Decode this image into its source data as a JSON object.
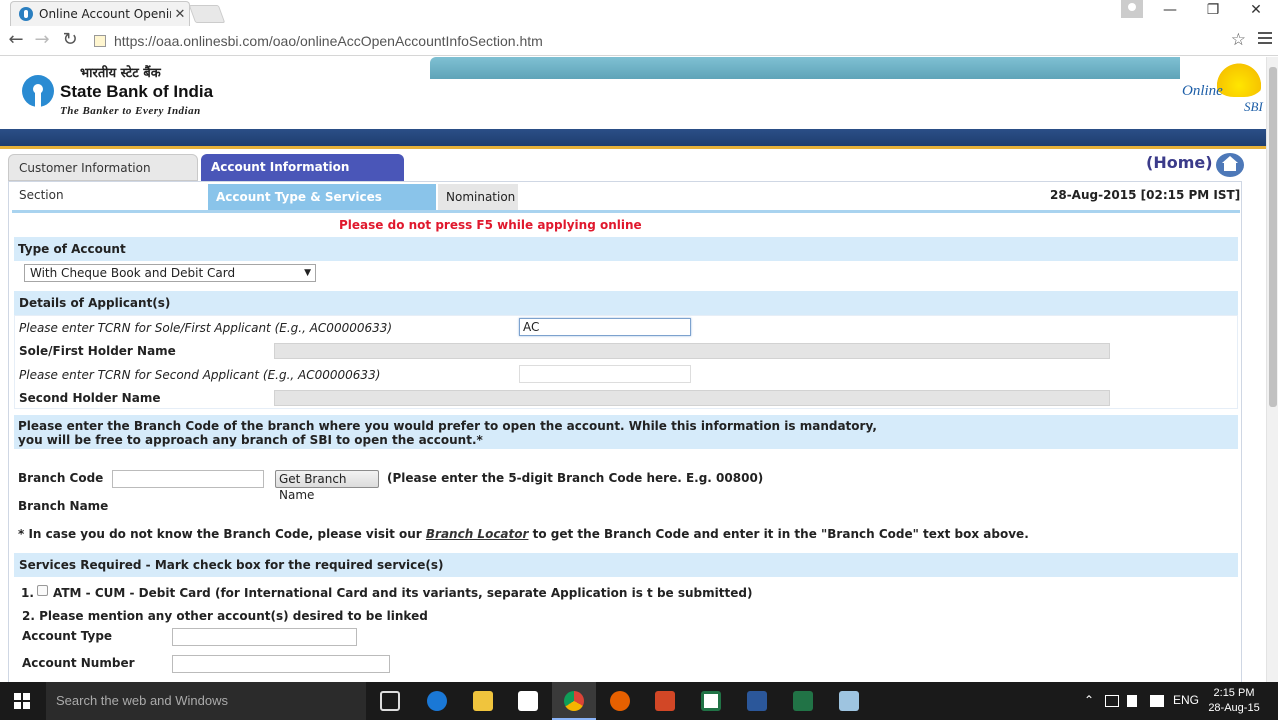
{
  "browser": {
    "tab_title": "Online Account Opening",
    "tab_close": "✕",
    "url": "https://oaa.onlinesbi.com/oao/onlineAccOpenAccountInfoSection.htm",
    "back_glyph": "←",
    "forward_glyph": "→",
    "reload_glyph": "↻",
    "star_glyph": "☆",
    "win_minimize": "—",
    "win_restore": "❐",
    "win_close": "✕"
  },
  "header": {
    "logo_hindi": "भारतीय स्टेट बैंक",
    "logo_name": "State Bank of India",
    "logo_tagline": "The Banker to Every Indian",
    "online_label": "Online",
    "sbi_label": "SBI"
  },
  "section_tabs": {
    "customer": "Customer Information Section",
    "account": "Account Information Section",
    "home": "(Home)"
  },
  "sub_tabs": {
    "account_type": "Account Type & Services Required",
    "nomination": "Nomination"
  },
  "datetime": "28-Aug-2015 [02:15 PM IST]",
  "warning": "Please do not press F5 while applying online",
  "type_of_account": {
    "heading": "Type of Account",
    "selected": "With Cheque Book and Debit Card",
    "arrow": "▼"
  },
  "applicants": {
    "heading": "Details of Applicant(s)",
    "tcrn_first_label": "Please enter TCRN for Sole/First Applicant (E.g., AC00000633)",
    "tcrn_first_value": "AC",
    "first_name_label": "Sole/First Holder Name",
    "tcrn_second_label": "Please enter TCRN for Second Applicant (E.g., AC00000633)",
    "tcrn_second_value": "",
    "second_name_label": "Second Holder Name"
  },
  "branch": {
    "notice_line1": "Please enter the Branch Code of the branch where you would prefer to open the account. While this information is mandatory,",
    "notice_line2": "you will be free to approach any branch of SBI to open the account.*",
    "code_label": "Branch Code",
    "code_value": "",
    "get_button": "Get Branch Name",
    "hint": "(Please enter the 5-digit Branch Code here. E.g. 00800)",
    "name_label": "Branch Name",
    "locator_prefix": "* In case you do not know the Branch Code, please visit our ",
    "locator_link": "Branch Locator",
    "locator_suffix": " to get the Branch Code and enter it in the \"Branch Code\" text box above."
  },
  "services": {
    "heading": "Services Required - Mark check box for the required service(s)",
    "item1_num": "1.",
    "item1_text": "ATM - CUM - Debit Card (for International Card and its variants, separate Application is t be submitted)",
    "item2_text": "2.  Please mention any other account(s) desired to be linked",
    "account_type_label": "Account Type",
    "account_type_value": "",
    "account_number_label": "Account Number",
    "account_number_value": ""
  },
  "taskbar": {
    "search_placeholder": "Search the web and Windows",
    "language": "ENG",
    "time": "2:15 PM",
    "date": "28-Aug-15",
    "tray_chevron": "⌃"
  },
  "colors": {
    "section_tab_active": "#4a56b8",
    "sub_tab_active": "#8ac4ea",
    "band": "#d6ebfa",
    "warning": "#e0182d",
    "header_bar": "#1c3a6b"
  }
}
